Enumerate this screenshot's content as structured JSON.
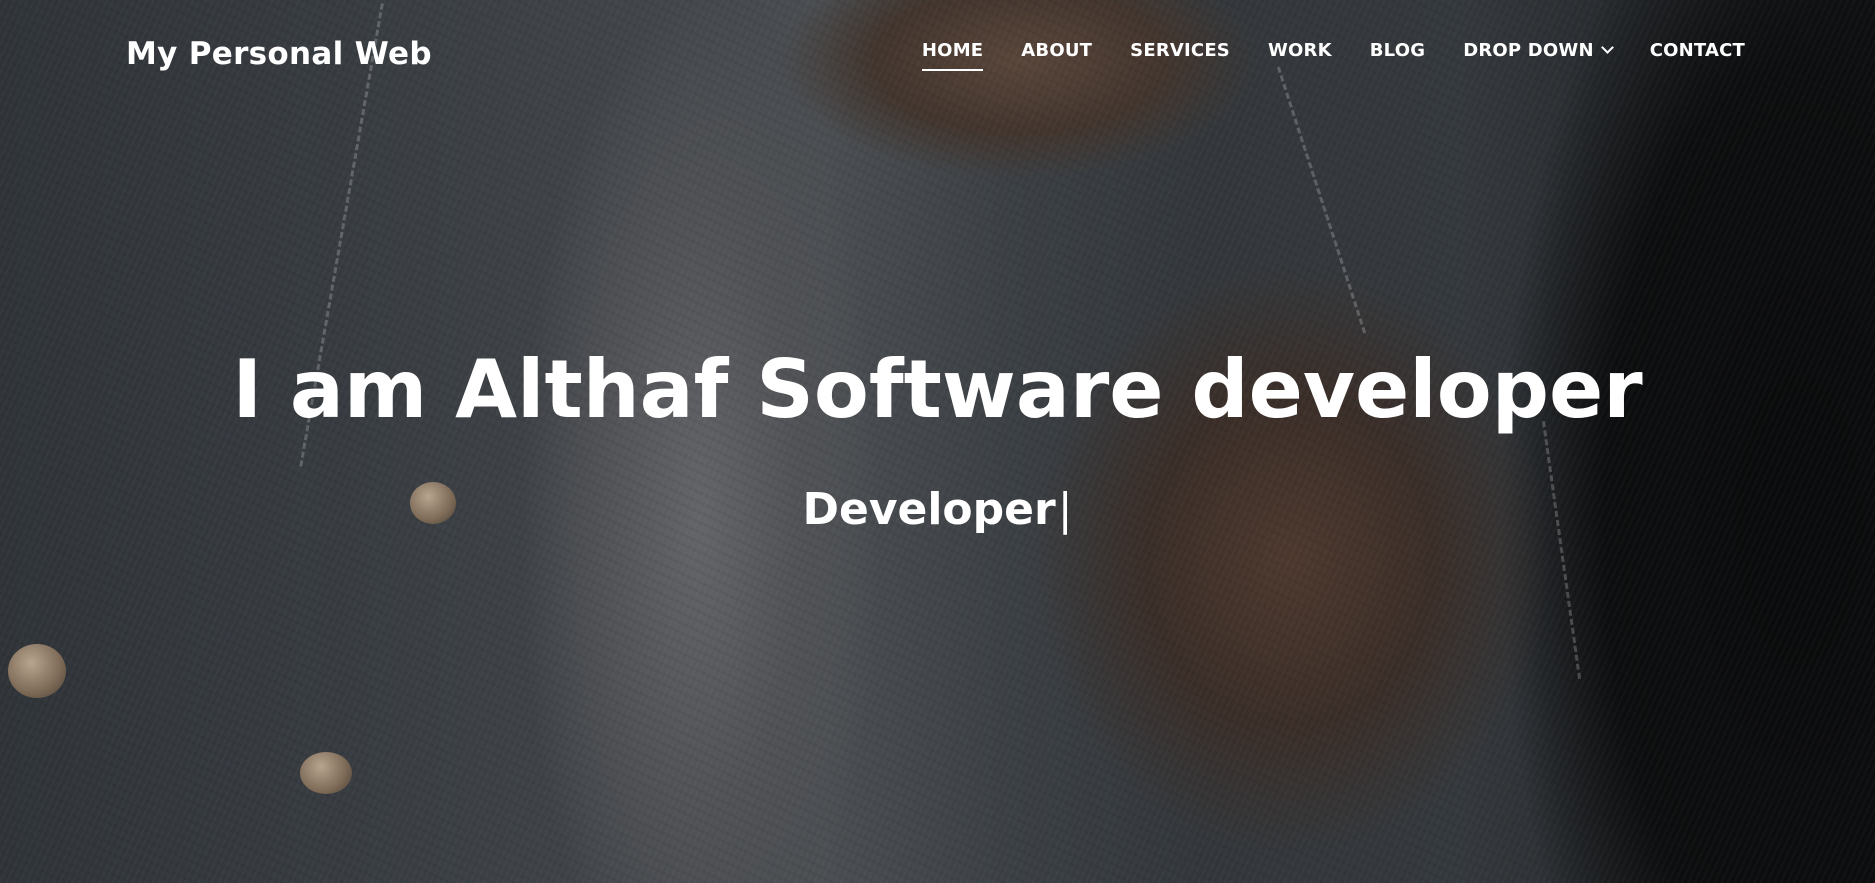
{
  "brand": {
    "title": "My Personal Web"
  },
  "nav": {
    "items": [
      {
        "label": "HOME",
        "active": true
      },
      {
        "label": "ABOUT",
        "active": false
      },
      {
        "label": "SERVICES",
        "active": false
      },
      {
        "label": "WORK",
        "active": false
      },
      {
        "label": "BLOG",
        "active": false
      },
      {
        "label": "DROP DOWN",
        "active": false,
        "icon": "chevron-down-icon"
      },
      {
        "label": "CONTACT",
        "active": false
      }
    ]
  },
  "hero": {
    "headline": "I am Althaf Software developer",
    "typed_text": "Developer",
    "cursor": "|"
  },
  "colors": {
    "text": "#ffffff",
    "overlay": "#14161a"
  }
}
